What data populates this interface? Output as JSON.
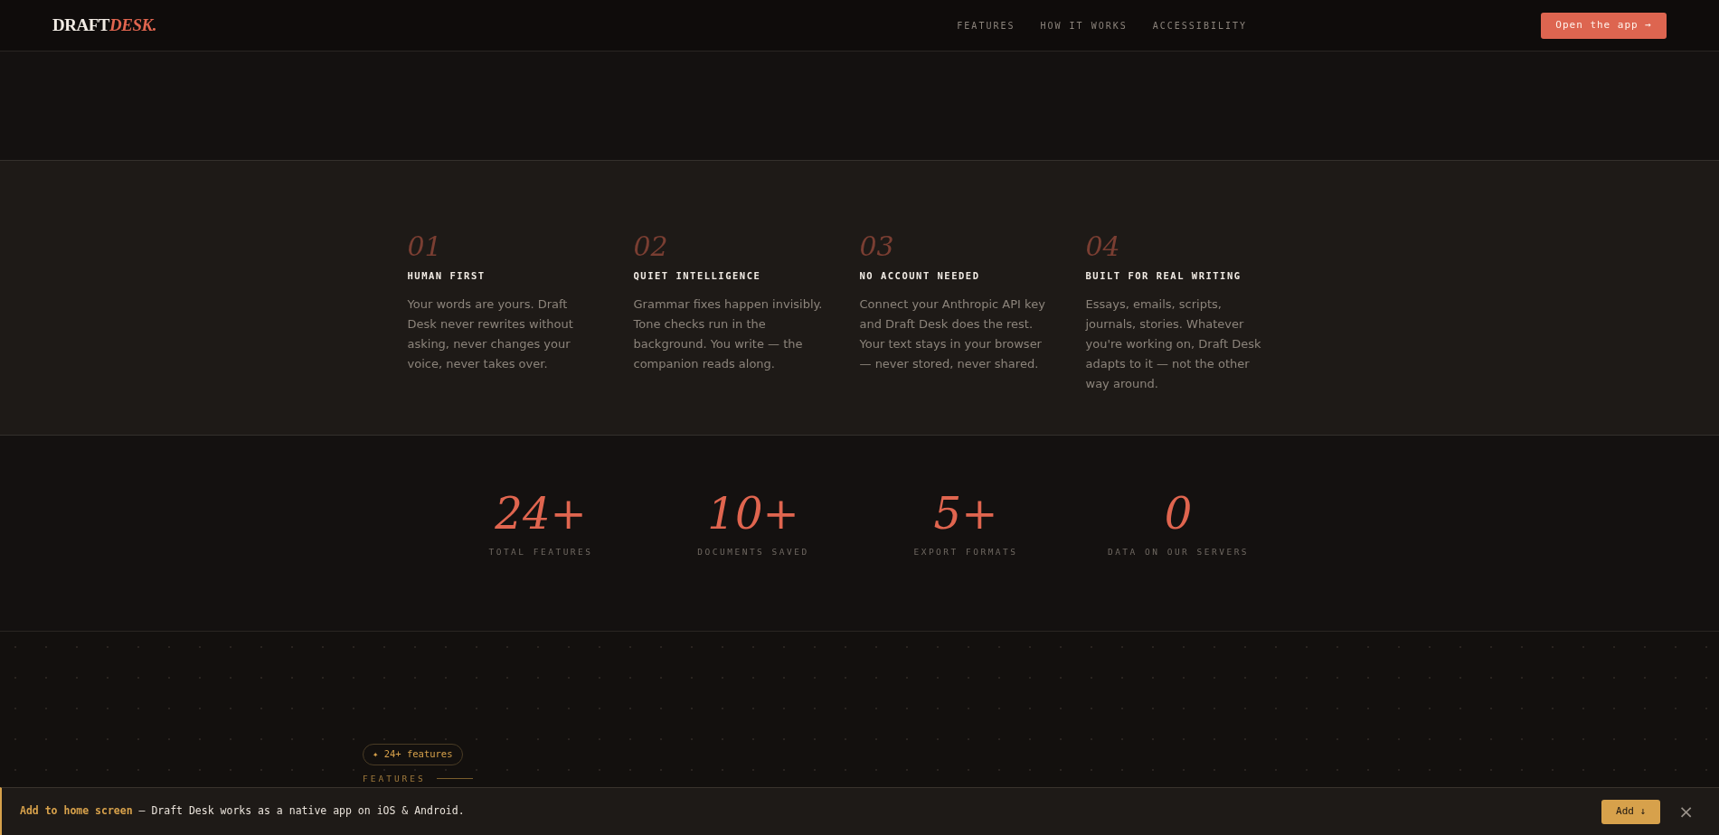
{
  "header": {
    "logo": {
      "primary": "DRAFT",
      "accent": "DESK."
    },
    "nav": [
      "FEATURES",
      "HOW IT WORKS",
      "ACCESSIBILITY"
    ],
    "cta": "Open the app →"
  },
  "principles": [
    {
      "number": "01",
      "title": "HUMAN FIRST",
      "text": "Your words are yours. Draft Desk never rewrites without asking, never changes your voice, never takes over."
    },
    {
      "number": "02",
      "title": "QUIET INTELLIGENCE",
      "text": "Grammar fixes happen invisibly. Tone checks run in the background. You write — the companion reads along."
    },
    {
      "number": "03",
      "title": "NO ACCOUNT NEEDED",
      "text": "Connect your Anthropic API key and Draft Desk does the rest. Your text stays in your browser — never stored, never shared."
    },
    {
      "number": "04",
      "title": "BUILT FOR REAL WRITING",
      "text": "Essays, emails, scripts, journals, stories. Whatever you're working on, Draft Desk adapts to it — not the other way around."
    }
  ],
  "stats": [
    {
      "value": "24+",
      "label": "TOTAL FEATURES"
    },
    {
      "value": "10+",
      "label": "DOCUMENTS SAVED"
    },
    {
      "value": "5+",
      "label": "EXPORT FORMATS"
    },
    {
      "value": "0",
      "label": "DATA ON OUR SERVERS"
    }
  ],
  "features_section": {
    "badge": "✦ 24+ features",
    "eyebrow": "FEATURES"
  },
  "install_banner": {
    "lead": "Add to home screen",
    "text": " — Draft Desk works as a native app on iOS & Android.",
    "button": "Add ↓",
    "close": "×"
  }
}
